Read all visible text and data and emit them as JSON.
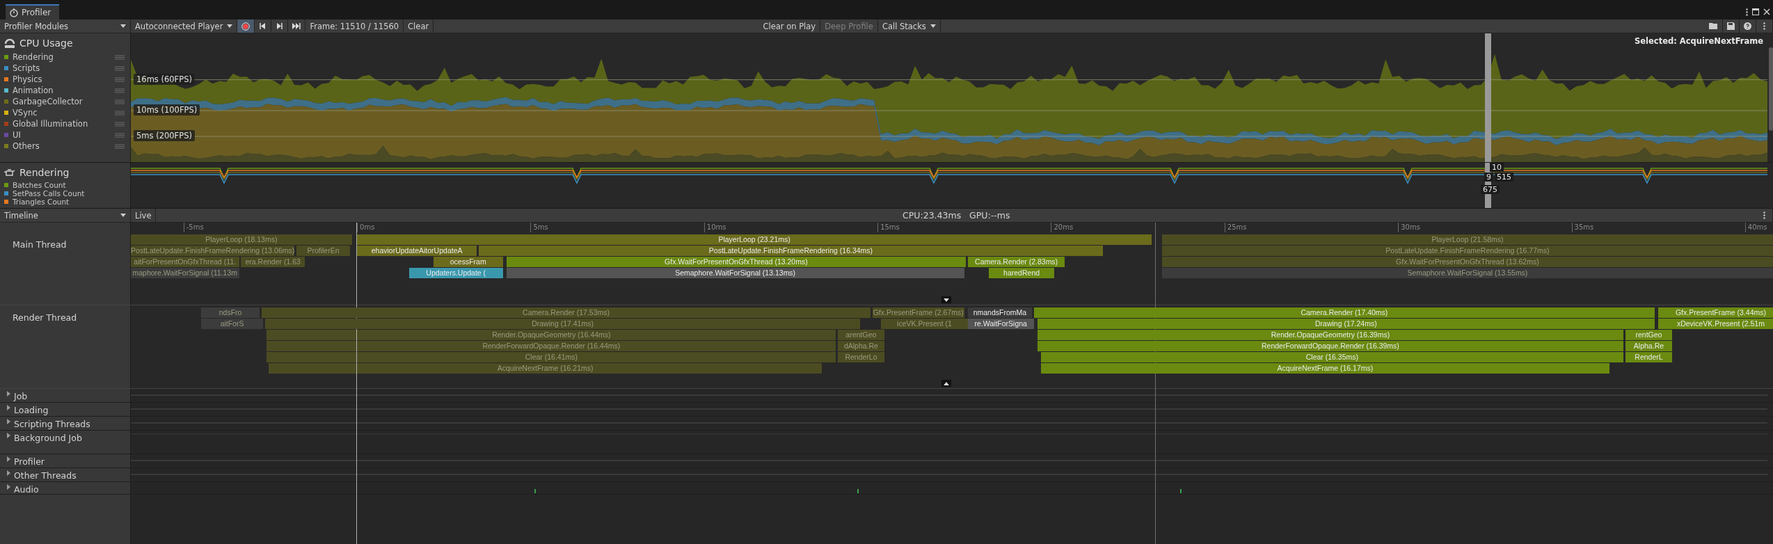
{
  "window": {
    "tab": "Profiler"
  },
  "toolbar": {
    "modules_dropdown": "Profiler Modules",
    "target_dropdown": "Autoconnected Player",
    "record": {
      "on": true
    },
    "frame": "Frame: 11510 / 11560",
    "clear": "Clear",
    "clear_on_play": "Clear on Play",
    "deep_profile": {
      "label": "Deep Profile",
      "disabled": true
    },
    "call_stacks": "Call Stacks"
  },
  "cpu_module": {
    "title": "CPU Usage",
    "legend": [
      {
        "name": "Rendering",
        "color": "#6a9a10"
      },
      {
        "name": "Scripts",
        "color": "#3b8fc4"
      },
      {
        "name": "Physics",
        "color": "#e7781f"
      },
      {
        "name": "Animation",
        "color": "#58b8c8"
      },
      {
        "name": "GarbageCollector",
        "color": "#6e6c1a"
      },
      {
        "name": "VSync",
        "color": "#d6b010"
      },
      {
        "name": "Global Illumination",
        "color": "#a33e1a"
      },
      {
        "name": "UI",
        "color": "#6a4aa0"
      },
      {
        "name": "Others",
        "color": "#7b7b1f"
      }
    ],
    "thresholds": [
      "16ms (60FPS)",
      "10ms (100FPS)",
      "5ms (200FPS)"
    ],
    "selected_label": "Selected: AcquireNextFrame"
  },
  "rendering_module": {
    "title": "Rendering",
    "legend": [
      {
        "name": "Batches Count",
        "color": "#6a9a10"
      },
      {
        "name": "SetPass Calls Count",
        "color": "#3b8fc4"
      },
      {
        "name": "Triangles Count",
        "color": "#e7781f"
      }
    ],
    "readouts": [
      "10",
      "9",
      "515",
      "675"
    ]
  },
  "timeline": {
    "view_dropdown": "Timeline",
    "live": "Live",
    "stats": "CPU:23.43ms   GPU:--ms",
    "ticks": [
      "-5ms",
      "0ms",
      "5ms",
      "10ms",
      "15ms",
      "20ms",
      "25ms",
      "30ms",
      "35ms",
      "40ms"
    ],
    "threads": [
      {
        "name": "Main Thread",
        "lanes": [
          {
            "bars": [
              {
                "label": "PlayerLoop (18.13ms)",
                "color": "#4c4c22",
                "dimmed": true
              },
              {
                "label": "PlayerLoop (23.21ms)",
                "color": "#6b6b1c",
                "dimmed": false
              },
              {
                "label": "PlayerLoop (21.58ms)",
                "color": "#4c4c22",
                "dimmed": true
              }
            ]
          },
          {
            "bars": [
              {
                "label": "PostLateUpdate.FinishFrameRendering (13.06ms)",
                "color": "#4c4c22",
                "dimmed": true
              },
              {
                "label": "ProfilerEn",
                "color": "#4c4c22",
                "dimmed": true
              },
              {
                "label": "ehaviorUpdateAitorUpdateA",
                "color": "#6b6b1c",
                "dimmed": false
              },
              {
                "label": "PostLateUpdate.FinishFrameRendering (16.34ms)",
                "color": "#6b6b1c",
                "dimmed": false
              },
              {
                "label": "PostLateUpdate.FinishFrameRendering (16.77ms)",
                "color": "#4c4c22",
                "dimmed": true
              }
            ]
          },
          {
            "bars": [
              {
                "label": "aitForPresentOnGfxThread (11.",
                "color": "#4c4c22",
                "dimmed": true
              },
              {
                "label": "era.Render (1.63",
                "color": "#4c4c22",
                "dimmed": true
              },
              {
                "label": "ocessFram",
                "color": "#6b6b1c",
                "dimmed": false
              },
              {
                "label": "Gfx.WaitForPresentOnGfxThread (13.20ms)",
                "color": "#6a8a10",
                "dimmed": false
              },
              {
                "label": "Camera.Render (2.83ms)",
                "color": "#6a8a10",
                "dimmed": false
              },
              {
                "label": "Gfx.WaitForPresentOnGfxThread (13.62ms)",
                "color": "#4c4c22",
                "dimmed": true
              }
            ]
          },
          {
            "bars": [
              {
                "label": "maphore.WaitForSignal (11.13m",
                "color": "#3c3c3c",
                "dimmed": true
              },
              {
                "label": "Updaters.Update (",
                "color": "#3a98ad",
                "dimmed": false
              },
              {
                "label": "Semaphore.WaitForSignal (13.13ms)",
                "color": "#545454",
                "dimmed": false
              },
              {
                "label": "haredRend",
                "color": "#6a8a10",
                "dimmed": false
              },
              {
                "label": "Semaphore.WaitForSignal (13.55ms)",
                "color": "#3c3c3c",
                "dimmed": true
              }
            ]
          }
        ]
      },
      {
        "name": "Render Thread",
        "lanes": [
          {
            "bars": [
              {
                "label": "ndsFro",
                "color": "#3c3c3c",
                "dimmed": true
              },
              {
                "label": "Camera.Render (17.53ms)",
                "color": "#4c4c22",
                "dimmed": true
              },
              {
                "label": "Gfx.PresentFrame (2.67ms)",
                "color": "#4c4c22",
                "dimmed": true
              },
              {
                "label": "nmandsFromMa",
                "color": "#3a3a3a",
                "dimmed": false
              },
              {
                "label": "Camera.Render (17.40ms)",
                "color": "#6a8a10",
                "dimmed": false
              },
              {
                "label": "Gfx.PresentFrame (3.44ms)",
                "color": "#6a8a10",
                "dimmed": false
              }
            ]
          },
          {
            "bars": [
              {
                "label": "aitForS",
                "color": "#3c3c3c",
                "dimmed": true
              },
              {
                "label": "Drawing (17.41ms)",
                "color": "#4c4c22",
                "dimmed": true
              },
              {
                "label": "iceVK.Present (1",
                "color": "#4c4c22",
                "dimmed": true
              },
              {
                "label": "re.WaitForSigna",
                "color": "#545454",
                "dimmed": false
              },
              {
                "label": "Drawing (17.24ms)",
                "color": "#6a8a10",
                "dimmed": false
              },
              {
                "label": "xDeviceVK.Present (2.51m",
                "color": "#6a8a10",
                "dimmed": false
              }
            ]
          },
          {
            "bars": [
              {
                "label": "Render.OpaqueGeometry (16.44ms)",
                "color": "#4c4c22",
                "dimmed": true
              },
              {
                "label": "arentGeo",
                "color": "#4c4c22",
                "dimmed": true
              },
              {
                "label": "Render.OpaqueGeometry (16.39ms)",
                "color": "#6a8a10",
                "dimmed": false
              },
              {
                "label": "rentGeo",
                "color": "#6a8a10",
                "dimmed": false
              }
            ]
          },
          {
            "bars": [
              {
                "label": "RenderForwardOpaque.Render (16.44ms)",
                "color": "#4c4c22",
                "dimmed": true
              },
              {
                "label": "dAlpha.Re",
                "color": "#4c4c22",
                "dimmed": true
              },
              {
                "label": "RenderForwardOpaque.Render (16.39ms)",
                "color": "#6a8a10",
                "dimmed": false
              },
              {
                "label": "Alpha.Re",
                "color": "#6a8a10",
                "dimmed": false
              }
            ]
          },
          {
            "bars": [
              {
                "label": "Clear (16.41ms)",
                "color": "#4c4c22",
                "dimmed": true
              },
              {
                "label": "RenderLo",
                "color": "#4c4c22",
                "dimmed": true
              },
              {
                "label": "Clear (16.35ms)",
                "color": "#6a8a10",
                "dimmed": false
              },
              {
                "label": "RenderL",
                "color": "#6a8a10",
                "dimmed": false
              }
            ]
          },
          {
            "bars": [
              {
                "label": "AcquireNextFrame (16.21ms)",
                "color": "#4c4c22",
                "dimmed": true
              },
              {
                "label": "AcquireNextFrame (16.17ms)",
                "color": "#6a8a10",
                "dimmed": false
              }
            ]
          }
        ]
      }
    ],
    "groups": [
      {
        "name": "Job",
        "expanded": false
      },
      {
        "name": "Loading",
        "expanded": false
      },
      {
        "name": "Scripting Threads",
        "expanded": false
      },
      {
        "name": "Background Job",
        "expanded": false
      },
      {
        "name": "Profiler",
        "expanded": false
      },
      {
        "name": "Other Threads",
        "expanded": false
      },
      {
        "name": "Audio",
        "expanded": false
      }
    ]
  }
}
